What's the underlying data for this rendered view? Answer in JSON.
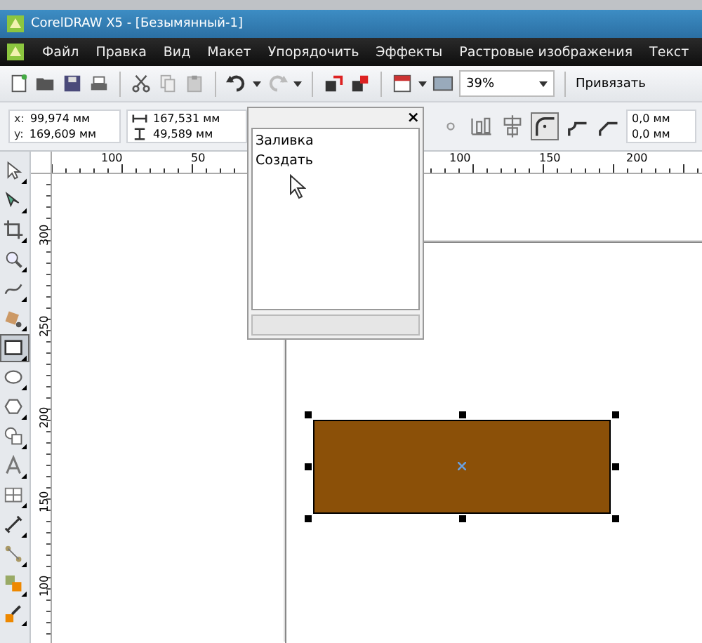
{
  "window": {
    "title": "CorelDRAW X5 - [Безымянный-1]"
  },
  "menu": [
    {
      "label": "Файл"
    },
    {
      "label": "Правка"
    },
    {
      "label": "Вид"
    },
    {
      "label": "Макет"
    },
    {
      "label": "Упорядочить"
    },
    {
      "label": "Эффекты"
    },
    {
      "label": "Растровые изображения"
    },
    {
      "label": "Текст"
    }
  ],
  "toolbar": {
    "zoom": "39%",
    "snap": "Привязать"
  },
  "properties": {
    "x_label": "x:",
    "x": "99,974 мм",
    "y_label": "y:",
    "y": "169,609 мм",
    "width": "167,531 мм",
    "height": "49,589 мм",
    "corner_1": "0,0 мм",
    "corner_2": "0,0 мм"
  },
  "rulers": {
    "top": [
      {
        "label": "100"
      },
      {
        "label": "50"
      },
      {
        "label": "100"
      },
      {
        "label": "150"
      },
      {
        "label": "200"
      }
    ],
    "left": [
      {
        "label": "300"
      },
      {
        "label": "250"
      },
      {
        "label": "200"
      },
      {
        "label": "150"
      },
      {
        "label": "100"
      }
    ]
  },
  "tools": [
    {
      "kind": "pick",
      "selected": false
    },
    {
      "kind": "shape",
      "selected": false
    },
    {
      "kind": "crop",
      "selected": false
    },
    {
      "kind": "zoom",
      "selected": false
    },
    {
      "kind": "curve",
      "selected": false
    },
    {
      "kind": "fill",
      "selected": false
    },
    {
      "kind": "rectangle",
      "selected": true
    },
    {
      "kind": "ellipse",
      "selected": false
    },
    {
      "kind": "polygon",
      "selected": false
    },
    {
      "kind": "shapes",
      "selected": false
    },
    {
      "kind": "text",
      "selected": false
    },
    {
      "kind": "table",
      "selected": false
    },
    {
      "kind": "dimension",
      "selected": false
    },
    {
      "kind": "connector",
      "selected": false
    },
    {
      "kind": "blend",
      "selected": false
    },
    {
      "kind": "eyedropper",
      "selected": false
    }
  ],
  "shape": {
    "kind": "rectangle",
    "color": "#8b5008",
    "selected": true
  },
  "context_menu": {
    "close": "×",
    "items": [
      {
        "label": "Заливка"
      },
      {
        "label": "Создать"
      }
    ]
  }
}
